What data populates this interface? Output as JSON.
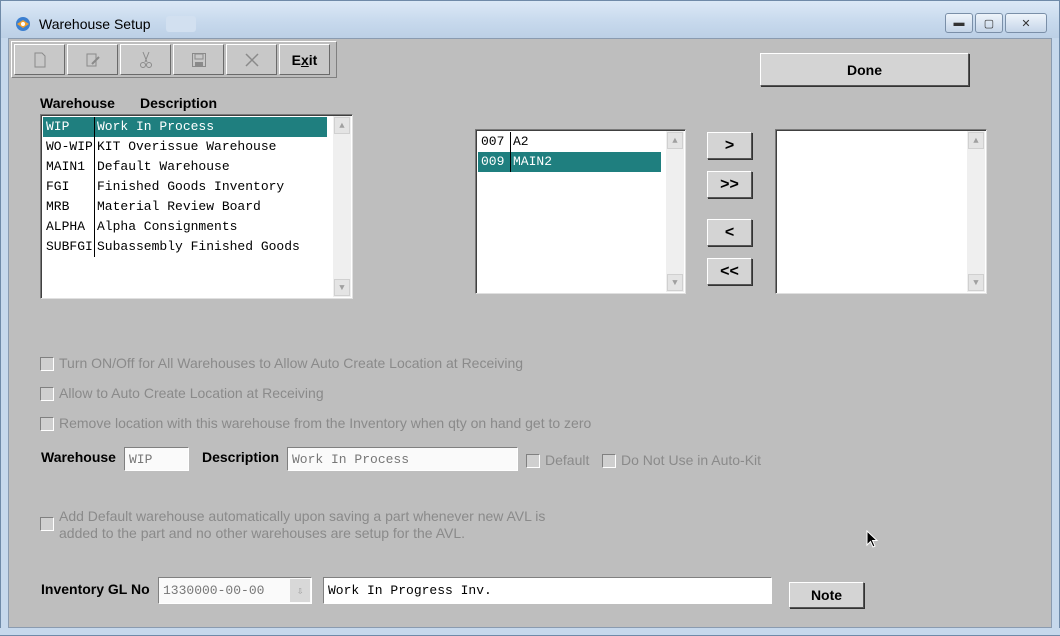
{
  "window": {
    "title": "Warehouse Setup"
  },
  "toolbar": {
    "buttons": [
      {
        "name": "new",
        "icon": "new-document-icon"
      },
      {
        "name": "edit",
        "icon": "edit-icon"
      },
      {
        "name": "cut",
        "icon": "scissors-icon"
      },
      {
        "name": "save",
        "icon": "save-icon"
      },
      {
        "name": "delete",
        "icon": "delete-x-icon"
      }
    ],
    "exit_pre": "E",
    "exit_u": "x",
    "exit_post": "it"
  },
  "done_label": "Done",
  "warehouse_list": {
    "header_warehouse": "Warehouse",
    "header_description": "Description",
    "rows": [
      {
        "code": "WIP",
        "desc": "Work In Process",
        "selected": true
      },
      {
        "code": "WO-WIP",
        "desc": "KIT Overissue Warehouse",
        "selected": false
      },
      {
        "code": "MAIN1",
        "desc": "Default Warehouse",
        "selected": false
      },
      {
        "code": "FGI",
        "desc": "Finished Goods Inventory",
        "selected": false
      },
      {
        "code": "MRB",
        "desc": "Material Review Board",
        "selected": false
      },
      {
        "code": "ALPHA",
        "desc": "Alpha Consignments",
        "selected": false
      },
      {
        "code": "SUBFGI",
        "desc": "Subassembly Finished Goods",
        "selected": false
      }
    ]
  },
  "available_list": {
    "rows": [
      {
        "code": "007",
        "desc": "A2",
        "selected": false
      },
      {
        "code": "009",
        "desc": "MAIN2",
        "selected": true
      }
    ]
  },
  "move_buttons": {
    "add_one": ">",
    "add_all": ">>",
    "remove_one": "<",
    "remove_all": "<<"
  },
  "options": {
    "all_auto_create": "Turn ON/Off for All Warehouses to Allow Auto Create Location at Receiving",
    "auto_create": "Allow to Auto Create Location at Receiving",
    "remove_location": "Remove location with this warehouse from the Inventory when qty on hand get to zero",
    "add_default_line1": "Add Default warehouse automatically upon saving a part whenever new AVL is",
    "add_default_line2": "added to the part and no other warehouses are setup for the AVL."
  },
  "detail": {
    "warehouse_label": "Warehouse",
    "warehouse_value": "WIP",
    "description_label": "Description",
    "description_value": "Work In Process",
    "default_label": "Default",
    "no_autokit_label": "Do Not Use in Auto-Kit"
  },
  "gl": {
    "label": "Inventory GL No",
    "value": "1330000-00-00",
    "description": "Work In Progress Inv.",
    "note_label": "Note"
  }
}
